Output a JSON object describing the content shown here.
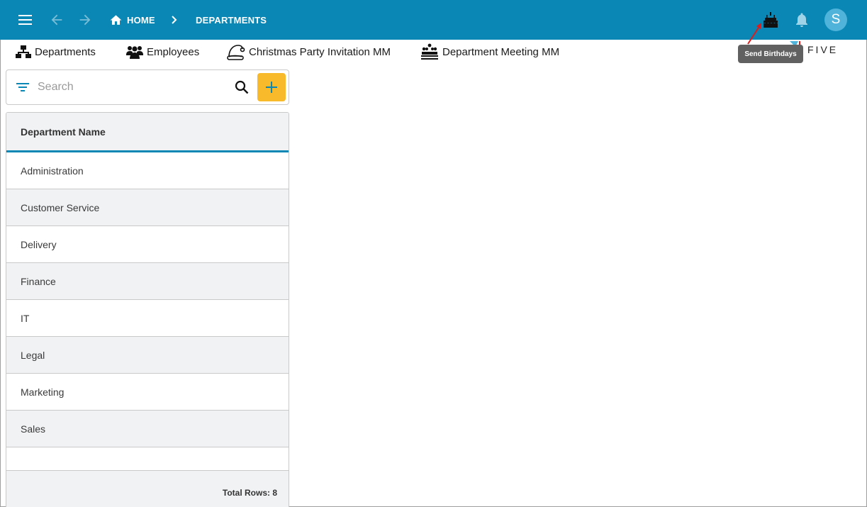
{
  "colors": {
    "accent": "#0a87b5",
    "add_button": "#f8ba2b",
    "avatar": "#4fb3da"
  },
  "header": {
    "breadcrumb_home": "HOME",
    "breadcrumb_current": "DEPARTMENTS",
    "avatar_initial": "S"
  },
  "menu": {
    "items": [
      {
        "label": "Departments",
        "icon": "sitemap-icon"
      },
      {
        "label": "Employees",
        "icon": "users-icon"
      },
      {
        "label": "Christmas Party Invitation MM",
        "icon": "santa-hat-icon"
      },
      {
        "label": "Department Meeting MM",
        "icon": "meeting-icon"
      }
    ]
  },
  "tooltip": {
    "text": "Send Birthdays"
  },
  "logo": {
    "text": "FIVE"
  },
  "search": {
    "placeholder": "Search",
    "value": ""
  },
  "list": {
    "column_header": "Department Name",
    "rows": [
      "Administration",
      "Customer Service",
      "Delivery",
      "Finance",
      "IT",
      "Legal",
      "Marketing",
      "Sales"
    ],
    "footer": "Total Rows: 8"
  }
}
